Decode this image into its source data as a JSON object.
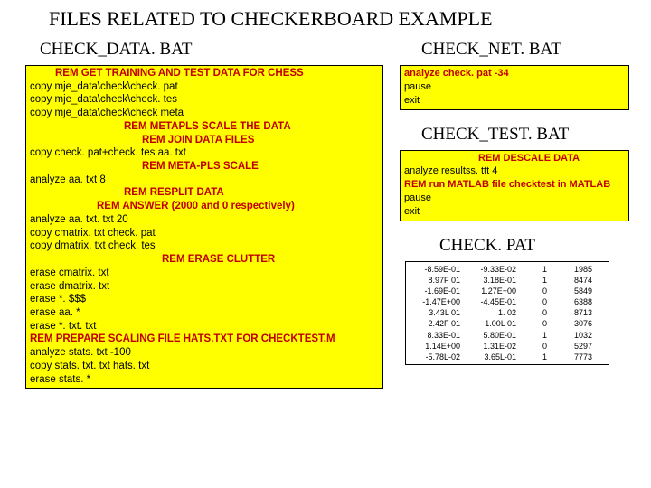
{
  "title": "FILES RELATED TO CHECKERBOARD EXAMPLE",
  "left": {
    "title": "CHECK_DATA. BAT",
    "lines": [
      {
        "text": "REM GET TRAINING AND TEST DATA FOR CHESS",
        "rem": true,
        "cls": "ind1"
      },
      {
        "text": "copy mje_data\\check\\check. pat"
      },
      {
        "text": "copy mje_data\\check\\check. tes"
      },
      {
        "text": "copy mje_data\\check\\check meta"
      },
      {
        "text": "REM METAPLS SCALE THE DATA",
        "rem": true,
        "cls": "ind2"
      },
      {
        "text": "REM JOIN DATA FILES",
        "rem": true,
        "cls": "ind3"
      },
      {
        "text": "copy check. pat+check. tes aa. txt"
      },
      {
        "text": "REM META-PLS SCALE",
        "rem": true,
        "cls": "ind3"
      },
      {
        "text": "analyze aa. txt 8"
      },
      {
        "text": "REM RESPLIT DATA",
        "rem": true,
        "cls": "ind2"
      },
      {
        "text": "REM ANSWER (2000 and 0 respectively)",
        "rem": true,
        "cls": "ind4"
      },
      {
        "text": "analyze aa. txt. txt 20"
      },
      {
        "text": "copy cmatrix. txt check. pat"
      },
      {
        "text": "copy dmatrix. txt check. tes"
      },
      {
        "text": "REM ERASE CLUTTER",
        "rem": true,
        "cls": "ind5"
      },
      {
        "text": "erase cmatrix. txt"
      },
      {
        "text": "erase dmatrix. txt"
      },
      {
        "text": "erase *. $$$"
      },
      {
        "text": "erase aa. *"
      },
      {
        "text": "erase *. txt. txt"
      },
      {
        "text": "REM PREPARE SCALING FILE HATS.TXT FOR CHECKTEST.M",
        "rem": true
      },
      {
        "text": "analyze stats. txt -100"
      },
      {
        "text": "copy stats. txt. txt hats. txt"
      },
      {
        "text": "erase stats. *"
      }
    ]
  },
  "net": {
    "title": "CHECK_NET. BAT",
    "lines": [
      {
        "text": " analyze check. pat -34",
        "rem": true
      },
      {
        "text": "pause"
      },
      {
        "text": "exit"
      }
    ]
  },
  "test": {
    "title": "CHECK_TEST. BAT",
    "lines": [
      {
        "text": "REM DESCALE DATA",
        "rem": true,
        "cls": "ind7"
      },
      {
        "text": "analyze resultss. ttt  4"
      },
      {
        "text": "REM run MATLAB file checktest in MATLAB",
        "rem": true
      },
      {
        "text": "pause"
      },
      {
        "text": "exit"
      }
    ]
  },
  "pat": {
    "title": "CHECK. PAT",
    "rows": [
      {
        "c1": "-8.59E-01",
        "c2": "-9.33E-02",
        "c3": "1",
        "c4": "1985"
      },
      {
        "c1": "8.97F 01",
        "c2": "3.18E-01",
        "c3": "1",
        "c4": "8474"
      },
      {
        "c1": "-1.69E-01",
        "c2": "1.27E+00",
        "c3": "0",
        "c4": "5849"
      },
      {
        "c1": "-1.47E+00",
        "c2": "-4.45E-01",
        "c3": "0",
        "c4": "6388"
      },
      {
        "c1": "3.43L 01",
        "c2": "1. 02",
        "c3": "0",
        "c4": "8713"
      },
      {
        "c1": "2.42F 01",
        "c2": "1.00L 01",
        "c3": "0",
        "c4": "3076"
      },
      {
        "c1": "8.33E-01",
        "c2": "5.80E-01",
        "c3": "1",
        "c4": "1032"
      },
      {
        "c1": "1.14E+00",
        "c2": "1.31E-02",
        "c3": "0",
        "c4": "5297"
      },
      {
        "c1": "-5.78L-02",
        "c2": "3.65L-01",
        "c3": "1",
        "c4": "7773"
      }
    ]
  }
}
